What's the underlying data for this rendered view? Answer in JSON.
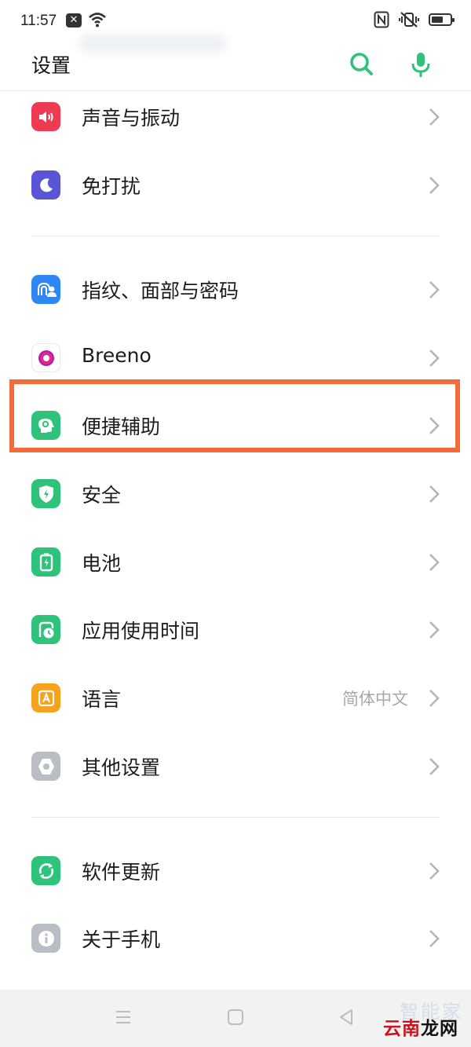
{
  "status_bar": {
    "time": "11:57",
    "icons": [
      "close-notification-icon",
      "wifi-icon",
      "nfc-icon",
      "vibrate-off-icon",
      "battery-icon"
    ]
  },
  "header": {
    "title": "设置",
    "search_icon": "search-icon",
    "mic_icon": "microphone-icon",
    "accent": "#2fc27a"
  },
  "settings": {
    "sound": {
      "label": "声音与振动",
      "icon": "speaker-icon",
      "color": "#ee3b52"
    },
    "dnd": {
      "label": "免打扰",
      "icon": "moon-icon",
      "color": "#5a54d6"
    },
    "biometrics": {
      "label": "指纹、面部与密码",
      "icon": "fingerprint-face-icon",
      "color": "#2f86f5"
    },
    "breeno": {
      "label": "Breeno",
      "icon": "breeno-icon",
      "color": "#d11ca5"
    },
    "accessibility": {
      "label": "便捷辅助",
      "icon": "accessibility-icon",
      "color": "#2fc27a"
    },
    "security": {
      "label": "安全",
      "icon": "shield-icon",
      "color": "#2fc27a"
    },
    "battery": {
      "label": "电池",
      "icon": "battery-charging-icon",
      "color": "#2fc27a"
    },
    "app_usage": {
      "label": "应用使用时间",
      "icon": "usage-timer-icon",
      "color": "#2fc27a"
    },
    "language": {
      "label": "语言",
      "value": "简体中文",
      "icon": "language-icon",
      "color": "#f7a21b"
    },
    "other": {
      "label": "其他设置",
      "icon": "hexagon-settings-icon",
      "color": "#b9bdc4"
    },
    "update": {
      "label": "软件更新",
      "icon": "refresh-icon",
      "color": "#2fc27a"
    },
    "about": {
      "label": "关于手机",
      "icon": "info-icon",
      "color": "#b9bdc4"
    }
  },
  "highlight_color": "#f26b39",
  "watermark": {
    "top": "智能家",
    "bottom_red": "云南",
    "bottom_black": "龙网"
  }
}
